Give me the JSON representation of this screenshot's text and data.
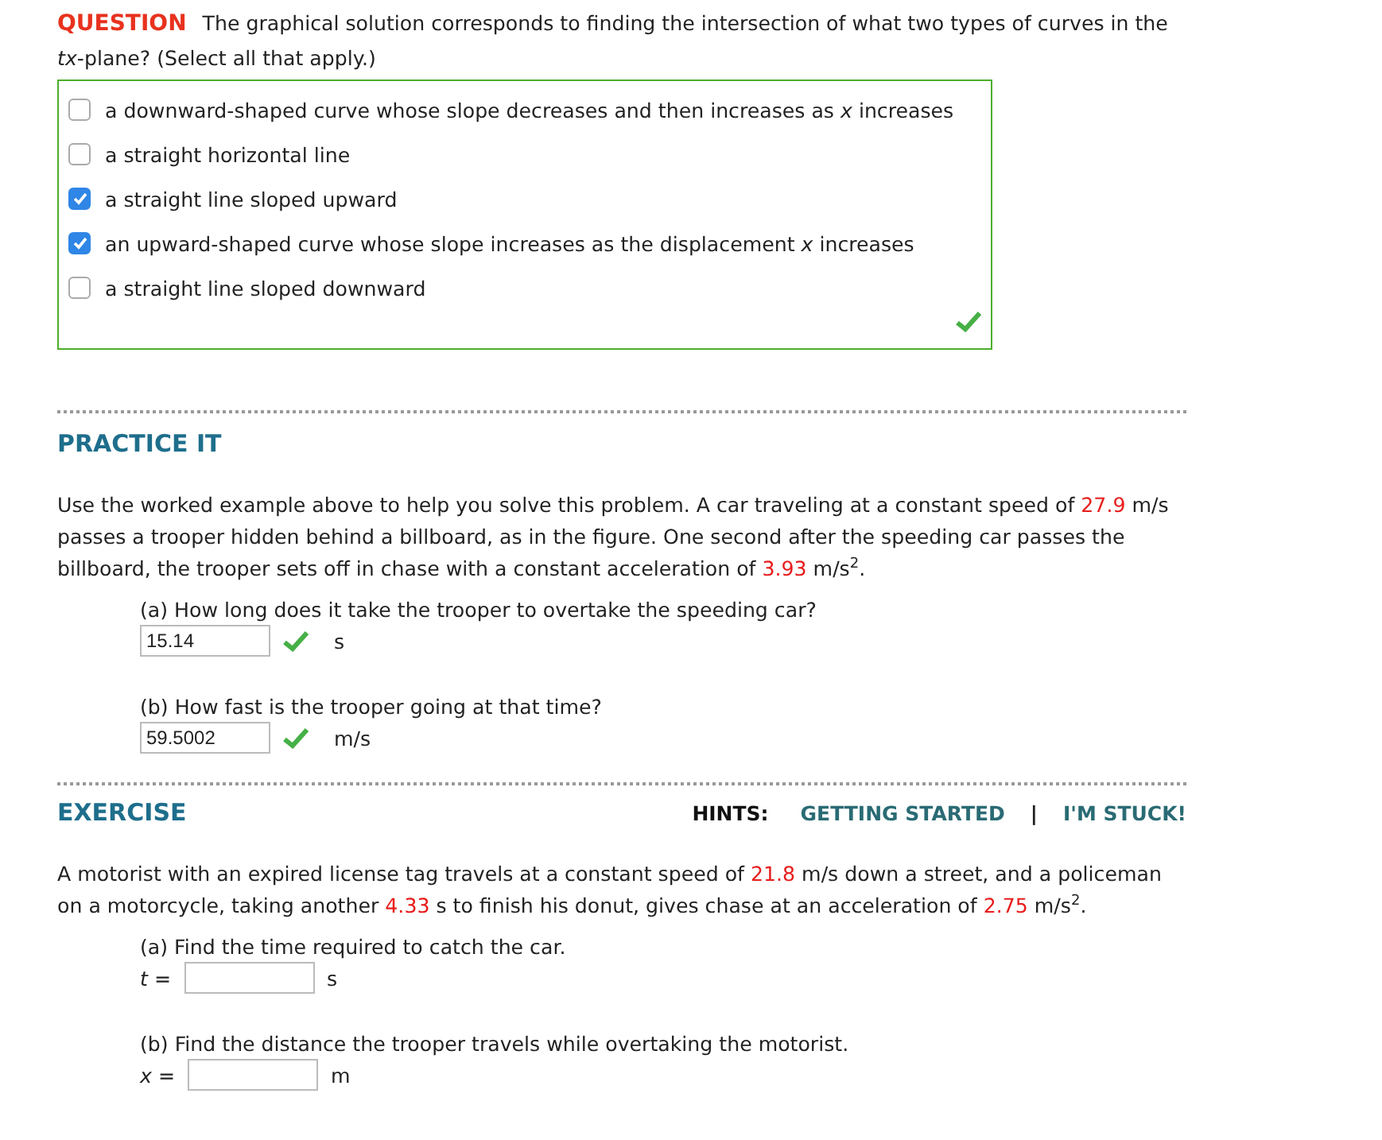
{
  "question": {
    "label": "QUESTION",
    "prompt": "The graphical solution corresponds to finding the intersection of what two types of curves in the *tx*-plane? (Select all that apply.)",
    "options": [
      {
        "text": "a downward-shaped curve whose slope decreases and then increases as *x* increases",
        "checked": false
      },
      {
        "text": "a straight horizontal line",
        "checked": false
      },
      {
        "text": "a straight line sloped upward",
        "checked": true
      },
      {
        "text": "an upward-shaped curve whose slope increases as the displacement *x* increases",
        "checked": true
      },
      {
        "text": "a straight line sloped downward",
        "checked": false
      }
    ],
    "correct": true
  },
  "practice": {
    "title": "PRACTICE IT",
    "problem": [
      {
        "text": "Use the worked example above to help you solve this problem. A car traveling at a constant speed of ",
        "kind": "plain"
      },
      {
        "text": "27.9",
        "kind": "given"
      },
      {
        "text": " m/s passes a trooper hidden behind a billboard, as in the figure. One second after the speeding car passes the billboard, the trooper sets off in chase with a constant acceleration of ",
        "kind": "plain"
      },
      {
        "text": "3.93",
        "kind": "given"
      },
      {
        "text": " m/s$^{2}$.",
        "kind": "plain"
      }
    ],
    "parts": [
      {
        "question": "(a) How long does it take the trooper to overtake the speeding car?",
        "value": "15.14",
        "correct": true,
        "unit": "s"
      },
      {
        "question": "(b) How fast is the trooper going at that time?",
        "value": "59.5002",
        "correct": true,
        "unit": "m/s"
      }
    ]
  },
  "exercise": {
    "title": "EXERCISE",
    "hints_label": "HINTS:",
    "hints": [
      "GETTING STARTED",
      "I'M STUCK!"
    ],
    "separator": "|",
    "problem": [
      {
        "text": "A motorist with an expired license tag travels at a constant speed of ",
        "kind": "plain"
      },
      {
        "text": "21.8",
        "kind": "given"
      },
      {
        "text": " m/s down a street, and a policeman on a motorcycle, taking another ",
        "kind": "plain"
      },
      {
        "text": "4.33",
        "kind": "given"
      },
      {
        "text": " s to finish his donut, gives chase at an acceleration of ",
        "kind": "plain"
      },
      {
        "text": "2.75",
        "kind": "given"
      },
      {
        "text": " m/s$^{2}$.",
        "kind": "plain"
      }
    ],
    "parts": [
      {
        "question": "(a) Find the time required to catch the car.",
        "label": "*t* =",
        "unit": "s"
      },
      {
        "question": "(b) Find the distance the trooper travels while overtaking the motorist.",
        "label": "*x* =",
        "unit": "m"
      }
    ]
  }
}
